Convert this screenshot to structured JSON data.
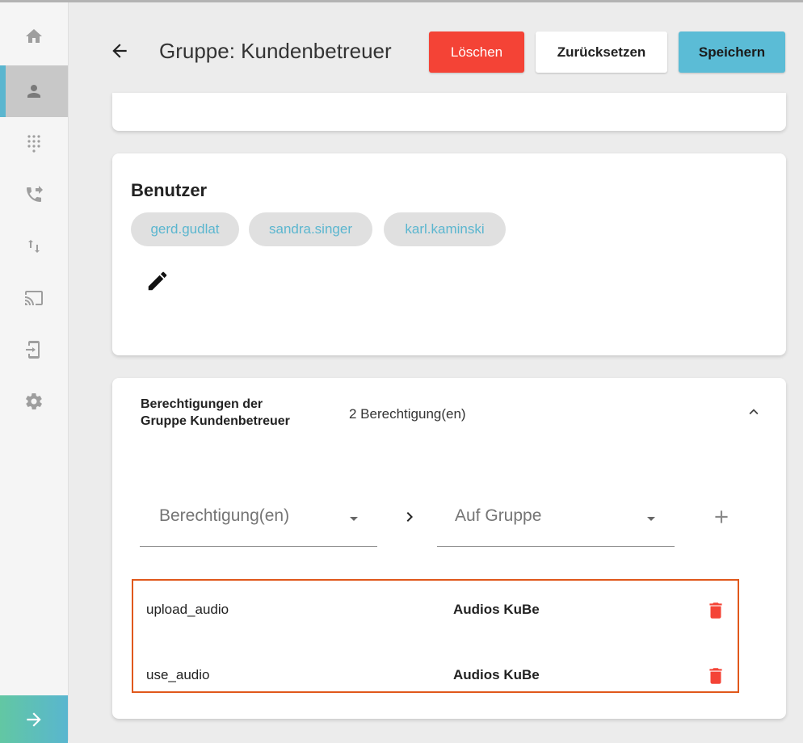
{
  "colors": {
    "accent": "#5bb6cf",
    "danger": "#f44336",
    "highlight_border": "#e0581b"
  },
  "sidebar": {
    "items": [
      {
        "icon": "home-icon",
        "active": false
      },
      {
        "icon": "user-icon",
        "active": true
      },
      {
        "icon": "dialpad-icon",
        "active": false
      },
      {
        "icon": "call-forward-icon",
        "active": false
      },
      {
        "icon": "swap-vertical-icon",
        "active": false
      },
      {
        "icon": "cast-icon",
        "active": false
      },
      {
        "icon": "device-login-icon",
        "active": false
      },
      {
        "icon": "gear-icon",
        "active": false
      }
    ],
    "expand_icon": "arrow-right-icon"
  },
  "header": {
    "title": "Gruppe: Kundenbetreuer",
    "delete_label": "Löschen",
    "reset_label": "Zurücksetzen",
    "save_label": "Speichern"
  },
  "users": {
    "title": "Benutzer",
    "chips": [
      "gerd.gudlat",
      "sandra.singer",
      "karl.kaminski"
    ]
  },
  "permissions": {
    "title_line1": "Berechtigungen der",
    "title_line2": "Gruppe Kundenbetreuer",
    "count": "2 Berechtigung(en)",
    "permission_select_placeholder": "Berechtigung(en)",
    "group_select_placeholder": "Auf Gruppe",
    "rows": [
      {
        "name": "upload_audio",
        "group": "Audios KuBe"
      },
      {
        "name": "use_audio",
        "group": "Audios KuBe"
      }
    ]
  }
}
